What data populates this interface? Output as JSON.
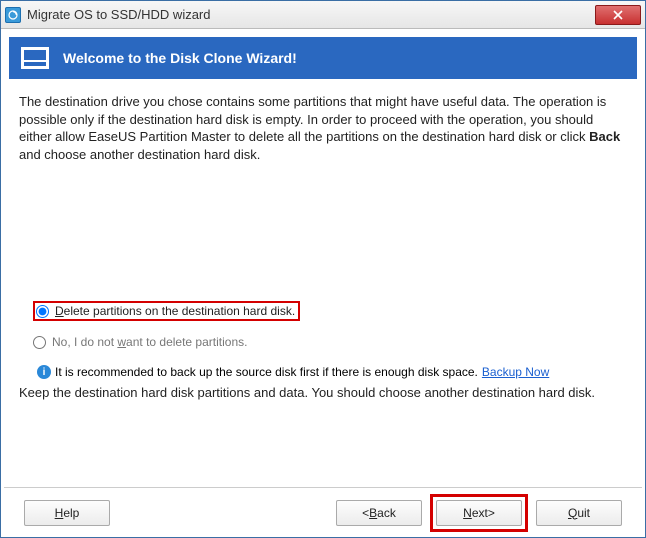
{
  "window": {
    "title": "Migrate OS to SSD/HDD wizard"
  },
  "banner": {
    "title": "Welcome to the Disk Clone Wizard!"
  },
  "intro": {
    "part1": "The destination drive you chose contains some partitions that might have useful data. The operation is possible only if the destination hard disk is empty. In order to proceed with the operation, you should either allow EaseUS Partition Master to delete all the partitions on the destination hard disk or click ",
    "back_word": "Back",
    "part2": " and choose another destination hard disk."
  },
  "options": {
    "delete": {
      "prefix": "D",
      "rest": "elete partitions on the destination hard disk."
    },
    "keep": {
      "prefix": "No, I do not ",
      "underlined": "w",
      "rest": "ant to delete partitions."
    }
  },
  "recommendation": {
    "text": "It is recommended to back up the source disk first if there is enough disk space. ",
    "link": "Backup Now"
  },
  "keep_note": "Keep the destination hard disk partitions and data. You should choose another destination hard disk.",
  "buttons": {
    "help": {
      "h": "H",
      "rest": "elp"
    },
    "back": {
      "lt": "<",
      "b": "B",
      "rest": "ack"
    },
    "next": {
      "n": "N",
      "rest": "ext",
      "gt": ">"
    },
    "quit": {
      "q": "Q",
      "rest": "uit"
    }
  }
}
